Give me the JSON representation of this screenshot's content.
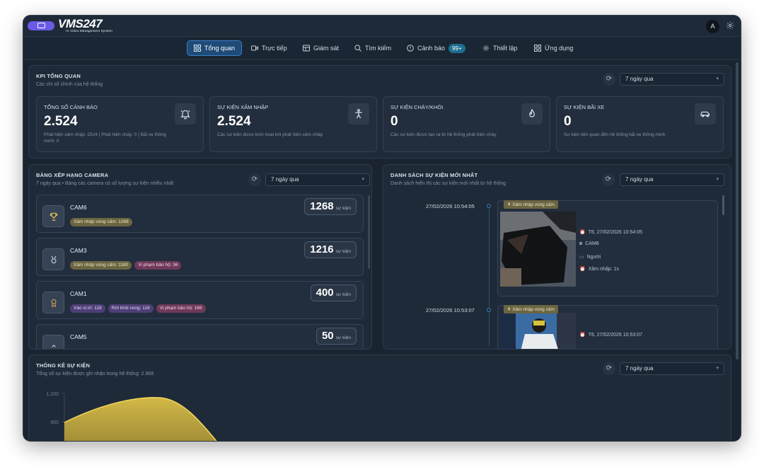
{
  "app": {
    "logo": "VMS247",
    "logo_sub": "AI Video Management System",
    "avatar": "A"
  },
  "nav": {
    "items": [
      {
        "label": "Tổng quan",
        "icon": "grid-icon"
      },
      {
        "label": "Trực tiếp",
        "icon": "video-icon"
      },
      {
        "label": "Giám sát",
        "icon": "monitor-icon"
      },
      {
        "label": "Tìm kiếm",
        "icon": "search-icon"
      },
      {
        "label": "Cảnh báo",
        "icon": "alert-icon"
      },
      {
        "label": "Thiết lập",
        "icon": "gear-icon"
      },
      {
        "label": "Ứng dụng",
        "icon": "apps-icon"
      }
    ],
    "alert_badge": "99+"
  },
  "kpi": {
    "title": "KPI TỔNG QUAN",
    "subtitle": "Các chỉ số chính của hệ thống",
    "range": "7 ngày qua",
    "cards": [
      {
        "label": "TỔNG SỐ CẢNH BÁO",
        "value": "2.524",
        "desc": "Phát hiện xâm nhập: 2524 | Phát hiện cháy: 0 | Bãi xe thông minh: 0",
        "icon": "bell-icon"
      },
      {
        "label": "SỰ KIỆN XÂM NHẬP",
        "value": "2.524",
        "desc": "Các sự kiện được kích hoạt khi phát hiện xâm nhập",
        "icon": "person-icon"
      },
      {
        "label": "SỰ KIỆN CHÁY/KHÓI",
        "value": "0",
        "desc": "Các sự kiện được tạo ra từ hệ thống phát hiện cháy",
        "icon": "flame-icon"
      },
      {
        "label": "SỰ KIỆN BÃI XE",
        "value": "0",
        "desc": "Sự kiện liên quan đến hệ thống bãi xe thông minh",
        "icon": "car-icon"
      }
    ]
  },
  "ranking": {
    "title": "BẢNG XẾP HẠNG CAMERA",
    "subtitle": "7 ngày qua • Bảng các camera có số lượng sự kiện nhiều nhất",
    "range": "7 ngày qua",
    "unit": "sự kiện",
    "rows": [
      {
        "name": "CAM6",
        "count": "1268",
        "tags": [
          {
            "text": "Xâm nhập vùng cấm: 1268",
            "tone": "olive"
          }
        ]
      },
      {
        "name": "CAM3",
        "count": "1216",
        "tags": [
          {
            "text": "Xâm nhập vùng cấm: 1180",
            "tone": "olive"
          },
          {
            "text": "Vi phạm bảo hộ: 36",
            "tone": "rose"
          }
        ]
      },
      {
        "name": "CAM1",
        "count": "400",
        "tags": [
          {
            "text": "Vào vị trí: 118",
            "tone": "purple"
          },
          {
            "text": "Rời khỏi vùng: 116",
            "tone": "purple"
          },
          {
            "text": "Vi phạm bảo hộ: 166",
            "tone": "rose"
          }
        ]
      },
      {
        "name": "CAM5",
        "count": "50",
        "tags": []
      }
    ]
  },
  "events": {
    "title": "DANH SÁCH SỰ KIỆN MỚI NHẤT",
    "subtitle": "Danh sách hiển thị các sự kiện mới nhất từ hệ thống",
    "range": "7 ngày qua",
    "items": [
      {
        "time": "27/02/2026 10:54:05",
        "tag": "Xâm nhập vùng cấm",
        "datetime": "T6, 27/02/2026 10:54:05",
        "camera": "CAM8",
        "object": "Người",
        "duration": "Xâm nhập: 1s"
      },
      {
        "time": "27/02/2026 10:53:07",
        "tag": "Xâm nhập vùng cấm",
        "datetime": "T6, 27/02/2026 10:53:07"
      }
    ]
  },
  "stats": {
    "title": "THỐNG KÊ SỰ KIỆN",
    "subtitle": "Tổng số sự kiện được ghi nhận trong hệ thống: 2.969",
    "range": "7 ngày qua",
    "y_ticks": [
      "1.200",
      "900"
    ]
  },
  "colors": {
    "accent": "#3a7fc4",
    "chart_line": "#e7c94a"
  }
}
